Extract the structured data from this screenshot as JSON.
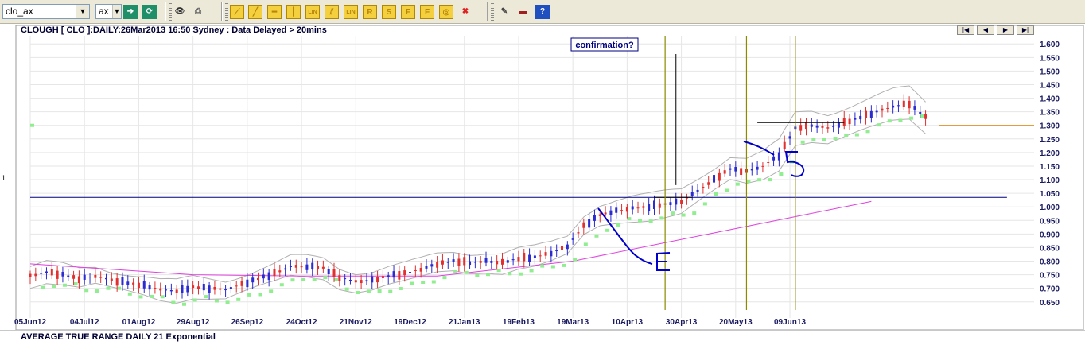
{
  "toolbar": {
    "symbol_value": "clo_ax",
    "exchange_value": "ax",
    "buttons": [
      {
        "name": "go-icon",
        "glyph": "➔",
        "color": "#1f8f6a"
      },
      {
        "name": "refresh-icon",
        "glyph": "⟳",
        "color": "#1f8f6a"
      },
      {
        "name": "binoculars-icon",
        "glyph": "👁",
        "color": "#333"
      },
      {
        "name": "print-icon",
        "glyph": "⎙",
        "color": "#666"
      },
      {
        "name": "trend-tool-icon",
        "glyph": "⟋",
        "color": "#b8860b"
      },
      {
        "name": "line-tool-icon",
        "glyph": "╱",
        "color": "#b8860b"
      },
      {
        "name": "horizontal-line-icon",
        "glyph": "━",
        "color": "#b8860b"
      },
      {
        "name": "vertical-line-icon",
        "glyph": "┃",
        "color": "#b8860b"
      },
      {
        "name": "label-lin-icon",
        "glyph": "LIN",
        "color": "#b8860b"
      },
      {
        "name": "channel-tool-icon",
        "glyph": "⫽",
        "color": "#b8860b"
      },
      {
        "name": "label-lin2-icon",
        "glyph": "LIN",
        "color": "#b8860b"
      },
      {
        "name": "retracement-icon",
        "glyph": "R",
        "color": "#b8860b"
      },
      {
        "name": "s-tool-icon",
        "glyph": "S",
        "color": "#b8860b"
      },
      {
        "name": "f-tool-icon",
        "glyph": "F",
        "color": "#b8860b"
      },
      {
        "name": "fx-tool-icon",
        "glyph": "F",
        "color": "#b8860b"
      },
      {
        "name": "cycle-tool-icon",
        "glyph": "◎",
        "color": "#b8860b"
      },
      {
        "name": "delete-icon",
        "glyph": "✖",
        "color": "#e02020"
      },
      {
        "name": "tools-icon",
        "glyph": "✎",
        "color": "#444"
      },
      {
        "name": "book-icon",
        "glyph": "▬",
        "color": "#a02020"
      },
      {
        "name": "help-icon",
        "glyph": "?",
        "color": "#ffffff"
      }
    ]
  },
  "header": {
    "title": "CLOUGH [ CLO ]:DAILY:26Mar2013 16:50 Sydney : Data Delayed > 20mins",
    "nav": [
      "|◀",
      "◀",
      "▶",
      "▶|"
    ]
  },
  "left_marker": "1",
  "annotation_box": "confirmation?",
  "bottom_panel_label": "AVERAGE TRUE RANGE DAILY 21 Exponential",
  "colors": {
    "up_candle": "#2b2bd0",
    "down_candle": "#e03030",
    "support_band": "#90ee90",
    "bollinger": "#b0b0b0",
    "moving_average": "#e040e0",
    "hand_drawn": "#0000cc",
    "vertical_markers": "#8b8b00",
    "target_line": "#e08000",
    "horizontal_lines": "#000080"
  },
  "chart_data": {
    "type": "candlestick",
    "title": "CLOUGH [ CLO ]:DAILY:26Mar2013 16:50 Sydney : Data Delayed > 20mins",
    "x_ticks": [
      "05Jun12",
      "04Jul12",
      "01Aug12",
      "29Aug12",
      "26Sep12",
      "24Oct12",
      "21Nov12",
      "19Dec12",
      "21Jan13",
      "19Feb13",
      "19Mar13",
      "10Apr13",
      "30Apr13",
      "20May13",
      "09Jun13"
    ],
    "y_ticks": [
      "1.600",
      "1.550",
      "1.500",
      "1.450",
      "1.400",
      "1.350",
      "1.300",
      "1.250",
      "1.200",
      "1.150",
      "1.100",
      "1.050",
      "1.000",
      "0.950",
      "0.900",
      "0.850",
      "0.800",
      "0.750",
      "0.700",
      "0.650"
    ],
    "ylim": [
      0.62,
      1.63
    ],
    "price_path": [
      [
        0,
        0.745
      ],
      [
        6,
        0.76
      ],
      [
        12,
        0.75
      ],
      [
        18,
        0.735
      ],
      [
        24,
        0.745
      ],
      [
        30,
        0.73
      ],
      [
        36,
        0.72
      ],
      [
        42,
        0.71
      ],
      [
        48,
        0.695
      ],
      [
        54,
        0.69
      ],
      [
        60,
        0.705
      ],
      [
        66,
        0.7
      ],
      [
        72,
        0.695
      ],
      [
        78,
        0.715
      ],
      [
        84,
        0.735
      ],
      [
        90,
        0.755
      ],
      [
        96,
        0.78
      ],
      [
        102,
        0.78
      ],
      [
        108,
        0.775
      ],
      [
        114,
        0.74
      ],
      [
        120,
        0.725
      ],
      [
        126,
        0.73
      ],
      [
        132,
        0.745
      ],
      [
        138,
        0.755
      ],
      [
        144,
        0.77
      ],
      [
        150,
        0.79
      ],
      [
        156,
        0.8
      ],
      [
        162,
        0.795
      ],
      [
        168,
        0.8
      ],
      [
        174,
        0.795
      ],
      [
        180,
        0.81
      ],
      [
        186,
        0.815
      ],
      [
        192,
        0.83
      ],
      [
        198,
        0.855
      ],
      [
        204,
        0.93
      ],
      [
        210,
        0.97
      ],
      [
        216,
        0.985
      ],
      [
        222,
        0.995
      ],
      [
        228,
        1.0
      ],
      [
        234,
        1.01
      ],
      [
        240,
        1.02
      ],
      [
        246,
        1.06
      ],
      [
        252,
        1.1
      ],
      [
        258,
        1.14
      ],
      [
        264,
        1.13
      ],
      [
        270,
        1.15
      ],
      [
        276,
        1.19
      ],
      [
        282,
        1.29
      ],
      [
        288,
        1.3
      ],
      [
        294,
        1.29
      ],
      [
        300,
        1.31
      ],
      [
        306,
        1.33
      ],
      [
        312,
        1.35
      ],
      [
        318,
        1.37
      ],
      [
        324,
        1.38
      ],
      [
        330,
        1.33
      ]
    ],
    "last_x_day": 330,
    "x_days_per_tick": 20,
    "x_range_days": [
      0,
      370
    ],
    "horizontal_lines": [
      1.035,
      0.97
    ],
    "target_level": 1.3,
    "range_top_line": 1.31,
    "vertical_marker_days": [
      234,
      264,
      282
    ],
    "confirmation_day": 238,
    "moving_average": [
      [
        150,
        0.745
      ],
      [
        200,
        0.8
      ],
      [
        250,
        0.9
      ],
      [
        280,
        0.96
      ],
      [
        310,
        1.02
      ]
    ],
    "legend": "none",
    "grid": true
  }
}
